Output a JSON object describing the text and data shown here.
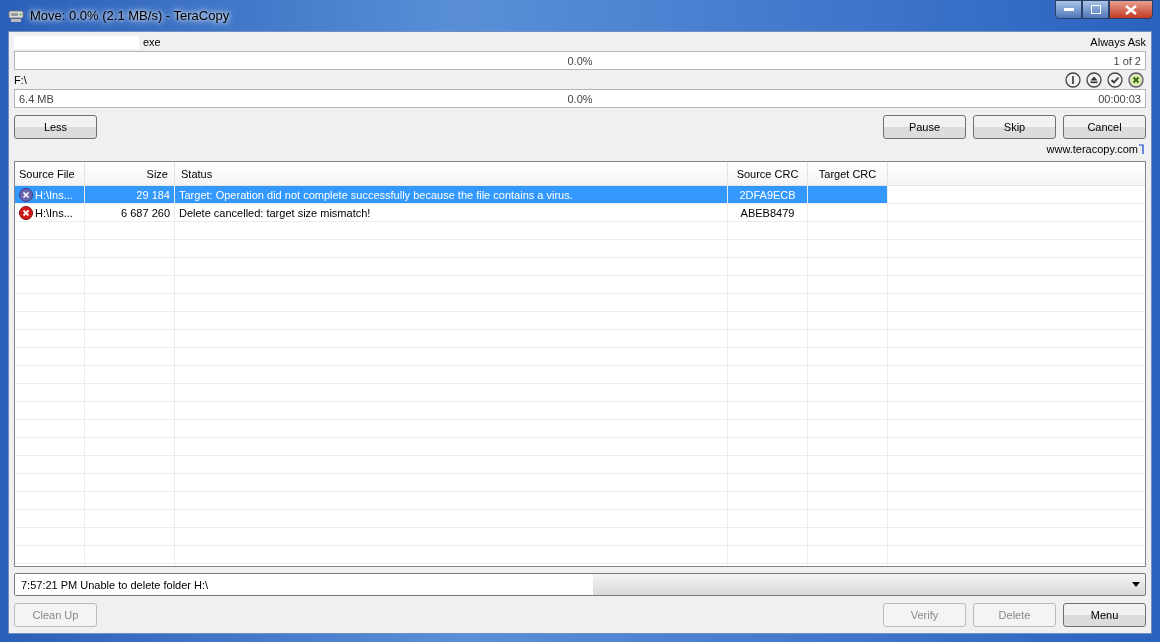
{
  "window": {
    "title": "Move: 0.0%  (2.1 MB/s) - TeraCopy"
  },
  "source": {
    "name": "exe",
    "mode": "Always Ask",
    "progress": {
      "level": 0,
      "percent": "0.0%",
      "count": "1 of 2"
    }
  },
  "target": {
    "path": "F:\\",
    "progress": {
      "level": 0,
      "size": "6.4 MB",
      "percent": "0.0%",
      "time": "00:00:03"
    }
  },
  "buttons_top": [
    {
      "label": "Less",
      "disabled": false
    }
  ],
  "buttons_right": [
    {
      "label": "Pause",
      "disabled": false
    },
    {
      "label": "Skip",
      "disabled": false
    },
    {
      "label": "Cancel",
      "disabled": false
    }
  ],
  "link": "www.teracopy.com",
  "table": {
    "columns": [
      "Source File",
      "Size",
      "Status",
      "Source CRC",
      "Target CRC"
    ],
    "rows": [
      {
        "kind": "skipped",
        "selected": true,
        "file": "H:\\Ins...",
        "size": "29 184",
        "status": "Target: Operation did not complete successfully because the file contains a virus.",
        "source_crc": "2DFA9ECB",
        "target_crc": ""
      },
      {
        "kind": "error",
        "selected": false,
        "file": "H:\\Ins...",
        "size": "6 687 260",
        "status": "Delete cancelled: target size mismatch!",
        "source_crc": "ABEB8479",
        "target_crc": ""
      }
    ]
  },
  "log": {
    "value": "7:57:21 PM Unable to delete folder H:\\"
  },
  "buttons_bottom_left": [
    {
      "label": "Clean Up",
      "disabled": true
    }
  ],
  "buttons_bottom_right": [
    {
      "label": "Verify",
      "disabled": true
    },
    {
      "label": "Delete",
      "disabled": true
    },
    {
      "label": "Menu",
      "disabled": false
    }
  ]
}
